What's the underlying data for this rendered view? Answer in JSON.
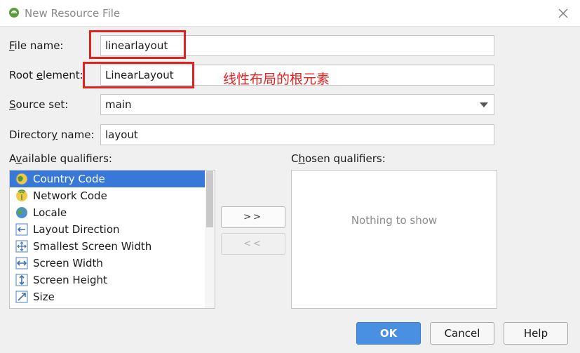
{
  "window": {
    "title": "New Resource File"
  },
  "form": {
    "file_name": {
      "label_key": "F",
      "label_rest": "ile name:",
      "value": "linearlayout"
    },
    "root_element": {
      "label_pre": "Root ",
      "label_key": "e",
      "label_rest": "lement:",
      "value": "LinearLayout"
    },
    "source_set": {
      "label_key": "S",
      "label_rest": "ource set:",
      "value": "main"
    },
    "directory_name": {
      "label_pre": "Director",
      "label_key": "y",
      "label_rest": " name:",
      "value": "layout"
    }
  },
  "annotation": {
    "text": "线性布局的根元素",
    "color": "#e1221f"
  },
  "available": {
    "label_pre": "A",
    "label_key": "v",
    "label_rest": "ailable qualifiers:",
    "items": [
      {
        "label": "Country Code",
        "icon": "globe-icon",
        "selected": true
      },
      {
        "label": "Network Code",
        "icon": "network-icon",
        "selected": false
      },
      {
        "label": "Locale",
        "icon": "locale-globe-icon",
        "selected": false
      },
      {
        "label": "Layout Direction",
        "icon": "layout-direction-icon",
        "selected": false
      },
      {
        "label": "Smallest Screen Width",
        "icon": "smallest-width-icon",
        "selected": false
      },
      {
        "label": "Screen Width",
        "icon": "screen-width-icon",
        "selected": false
      },
      {
        "label": "Screen Height",
        "icon": "screen-height-icon",
        "selected": false
      },
      {
        "label": "Size",
        "icon": "size-icon",
        "selected": false
      }
    ]
  },
  "chosen": {
    "label_pre": "C",
    "label_key": "h",
    "label_rest": "osen qualifiers:",
    "empty_text": "Nothing to show"
  },
  "buttons": {
    "add": ">>",
    "remove": "<<",
    "ok": "OK",
    "cancel": "Cancel",
    "help": "Help"
  },
  "colors": {
    "accent": "#3878d8",
    "primary_button": "#4a90e2",
    "highlight_box": "#e1221f"
  }
}
